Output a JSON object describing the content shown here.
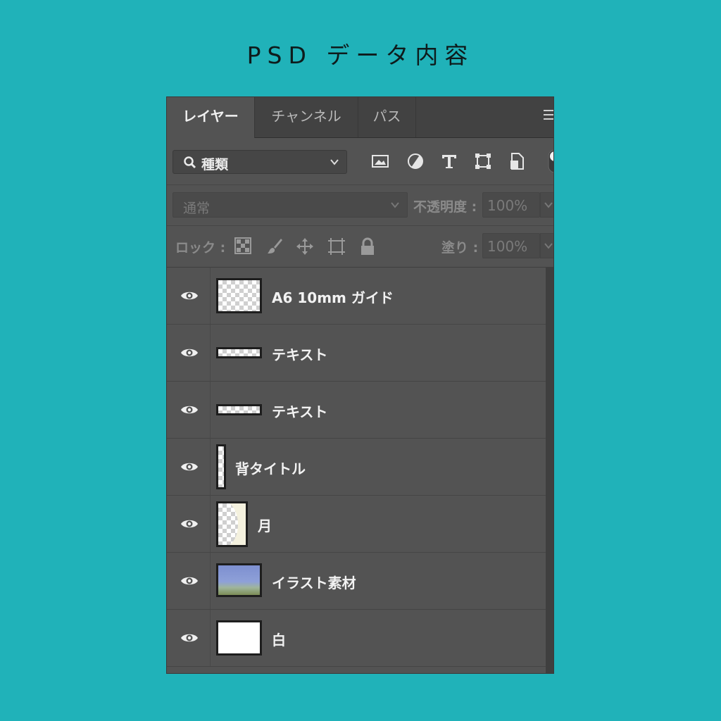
{
  "page": {
    "title": "PSD データ内容"
  },
  "panel": {
    "tabs": [
      {
        "label": "レイヤー",
        "active": true
      },
      {
        "label": "チャンネル",
        "active": false
      },
      {
        "label": "パス",
        "active": false
      }
    ],
    "menu_icon": "hamburger-menu-icon",
    "filter": {
      "label": "種類",
      "icons": [
        "search-icon",
        "image-filter-icon",
        "adjustment-filter-icon",
        "type-filter-icon",
        "shape-filter-icon",
        "smart-object-filter-icon"
      ]
    },
    "blend": {
      "mode": "通常",
      "opacity_label": "不透明度 :",
      "opacity_value": "100%"
    },
    "lock": {
      "label": "ロック :",
      "icons": [
        "lock-transparent-icon",
        "lock-image-icon",
        "lock-position-icon",
        "lock-artboard-icon",
        "lock-all-icon"
      ],
      "fill_label": "塗り :",
      "fill_value": "100%"
    },
    "layers": [
      {
        "name": "A6 10mm ガイド",
        "visible": true,
        "thumb": "transparent"
      },
      {
        "name": "テキスト",
        "visible": true,
        "thumb": "text-strip"
      },
      {
        "name": "テキスト",
        "visible": true,
        "thumb": "text-strip"
      },
      {
        "name": "背タイトル",
        "visible": true,
        "thumb": "spine"
      },
      {
        "name": "月",
        "visible": true,
        "thumb": "moon"
      },
      {
        "name": "イラスト素材",
        "visible": true,
        "thumb": "illustration"
      },
      {
        "name": "白",
        "visible": true,
        "thumb": "white"
      }
    ]
  },
  "colors": {
    "background": "#20b2b9",
    "panel": "#535353",
    "tabbar": "#424242",
    "text": "#f2f2f2"
  }
}
